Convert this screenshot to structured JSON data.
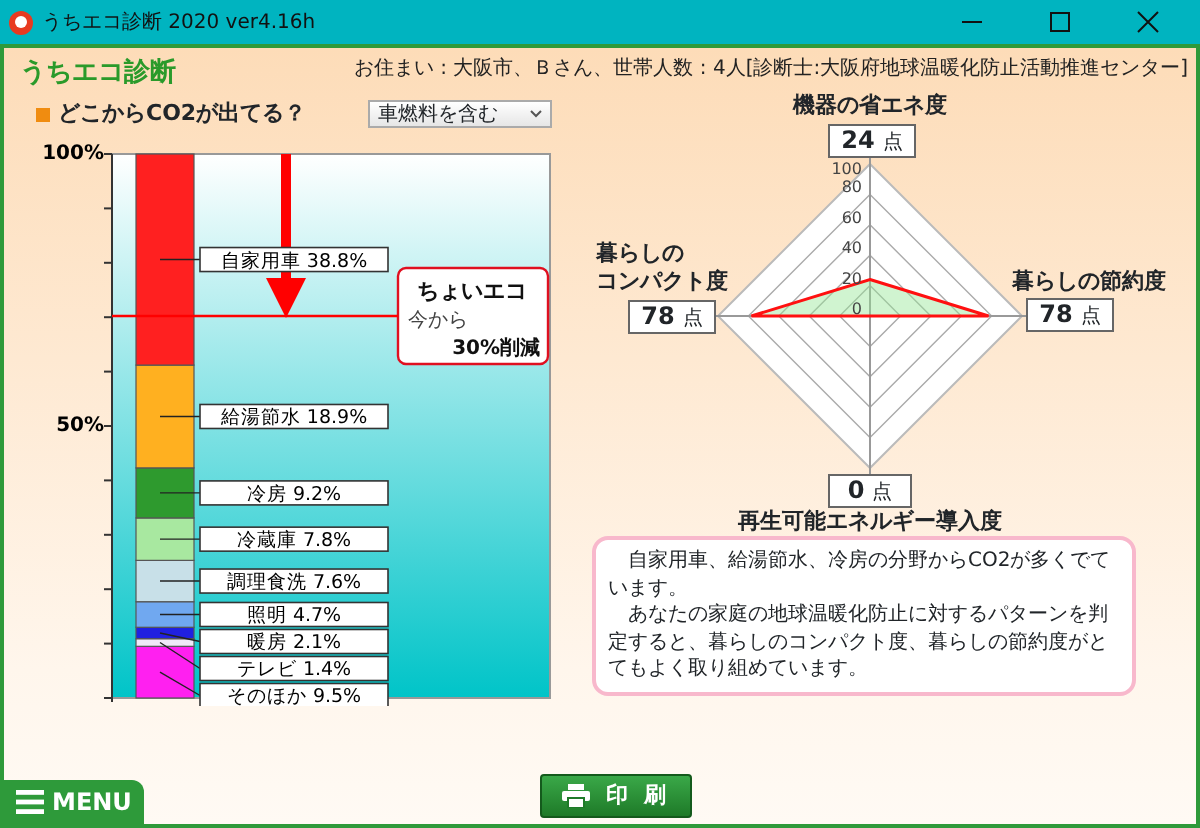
{
  "window": {
    "title": "うちエコ診断 2020 ver4.16h"
  },
  "header": {
    "app_title": "うちエコ診断",
    "household_info": "お住まい : 大阪市、Ｂさん、世帯人数 : 4人[診断士:大阪府地球温暖化防止活動推進センター]"
  },
  "left_panel": {
    "heading": "どこからCO2が出てる？",
    "dropdown": {
      "value": "車燃料を含む"
    },
    "chart_data": {
      "type": "bar",
      "stacked": true,
      "ylim": [
        0,
        100
      ],
      "yticks": [
        {
          "value": 50,
          "label": "50%"
        },
        {
          "value": 100,
          "label": "100%"
        }
      ],
      "series": [
        {
          "name": "そのほか",
          "color": "#ff20f0",
          "values": [
            9.5
          ]
        },
        {
          "name": "テレビ",
          "color": "#f0e8f8",
          "values": [
            1.4
          ]
        },
        {
          "name": "暖房",
          "color": "#2020e0",
          "values": [
            2.1
          ]
        },
        {
          "name": "照明",
          "color": "#70a8f0",
          "values": [
            4.7
          ]
        },
        {
          "name": "調理食洗",
          "color": "#c8e0e8",
          "values": [
            7.6
          ]
        },
        {
          "name": "冷蔵庫",
          "color": "#a8e8a0",
          "values": [
            7.8
          ]
        },
        {
          "name": "冷房",
          "color": "#2e9a2e",
          "values": [
            9.2
          ]
        },
        {
          "name": "給湯節水",
          "color": "#ffb020",
          "values": [
            18.9
          ]
        },
        {
          "name": "自家用車",
          "color": "#ff2020",
          "values": [
            38.8
          ]
        }
      ],
      "value_labels": [
        "9.5%",
        "1.4%",
        "2.1%",
        "4.7%",
        "7.6%",
        "7.8%",
        "9.2%",
        "18.9%",
        "38.8%"
      ],
      "annotations": [
        {
          "text": "ちょいエコ"
        },
        {
          "text": "今から"
        },
        {
          "text": "30%削減"
        }
      ]
    }
  },
  "radar": {
    "ticks": [
      "100",
      "80",
      "60",
      "40",
      "20",
      "0"
    ],
    "axes": [
      {
        "label_lines": [
          "機器の省エネ度"
        ],
        "score": "24",
        "unit": "点"
      },
      {
        "label_lines": [
          "暮らしの節約度"
        ],
        "score": "78",
        "unit": "点"
      },
      {
        "label_lines": [
          "再生可能エネルギー導入度"
        ],
        "score": "0",
        "unit": "点"
      },
      {
        "label_lines": [
          "暮らしの",
          "コンパクト度"
        ],
        "score": "78",
        "unit": "点"
      }
    ]
  },
  "comment": {
    "paragraphs": [
      "　自家用車、給湯節水、冷房の分野からCO2が多くでています。",
      "　あなたの家庭の地球温暖化防止に対するパターンを判定すると、暮らしのコンパクト度、暮らしの節約度がとてもよく取り組めています。"
    ]
  },
  "footer": {
    "menu_button": "MENU",
    "print_button": "印 刷"
  }
}
